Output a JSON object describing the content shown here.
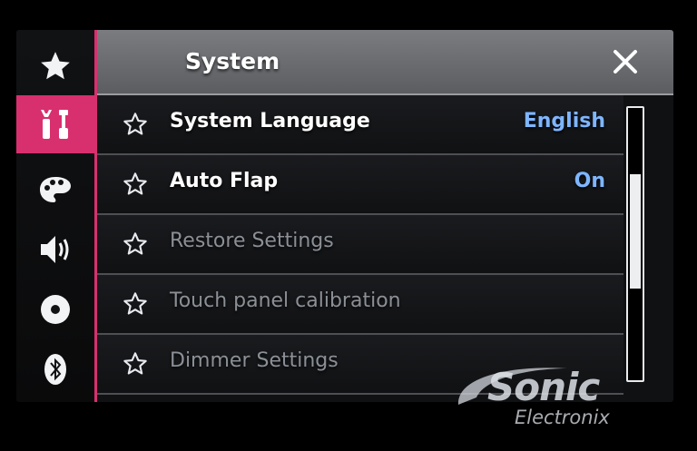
{
  "header": {
    "title": "System",
    "close_icon": "close-icon"
  },
  "sidebar": {
    "items": [
      {
        "icon": "favorites-star-icon",
        "active": false
      },
      {
        "icon": "settings-tools-icon",
        "active": true
      },
      {
        "icon": "theme-palette-icon",
        "active": false
      },
      {
        "icon": "audio-speaker-icon",
        "active": false
      },
      {
        "icon": "disc-icon",
        "active": false
      },
      {
        "icon": "bluetooth-icon",
        "active": false
      }
    ],
    "accent_color": "#d8306f"
  },
  "settings": {
    "rows": [
      {
        "label": "System Language",
        "value": "English",
        "enabled": true
      },
      {
        "label": "Auto Flap",
        "value": "On",
        "enabled": true
      },
      {
        "label": "Restore Settings",
        "value": "",
        "enabled": false
      },
      {
        "label": "Touch panel calibration",
        "value": "",
        "enabled": false
      },
      {
        "label": "Dimmer Settings",
        "value": "",
        "enabled": false
      }
    ],
    "value_color": "#7eb6ff"
  },
  "scrollbar": {
    "position_fraction": 0.42
  },
  "watermark": {
    "brand": "Sonic",
    "sub": "Electronix"
  }
}
